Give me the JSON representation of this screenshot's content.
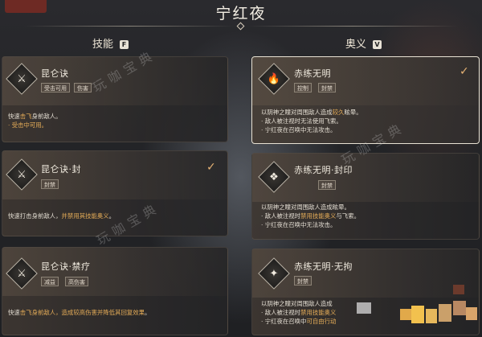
{
  "top_tab": "",
  "window_title": "宁红夜",
  "columns": {
    "skills": {
      "title": "技能",
      "key": "F"
    },
    "ultimates": {
      "title": "奥义",
      "key": "V"
    }
  },
  "watermark": "玩咖宝典",
  "colors": {
    "highlight": "#e6ad58",
    "check": "#e6b274",
    "tag_border": "#8c8376"
  },
  "left_cards": [
    {
      "name": "昆仑诀",
      "icon": "slash-dash-icon",
      "tags": [
        "受击可用",
        "伤害"
      ],
      "desc_prefix": "快速",
      "desc_hl": "击飞",
      "desc_suffix": "身前敌人。",
      "bullet_hl": "· 受击中可用。"
    },
    {
      "name": "昆仑诀·封",
      "icon": "slash-dash-icon",
      "tags": [
        "封禁"
      ],
      "checked": true,
      "desc_prefix": "快速打击身前敌人，",
      "desc_hl": "并禁用其技能奥义",
      "desc_suffix": "。"
    },
    {
      "name": "昆仑诀·禁疗",
      "icon": "slash-dash-icon",
      "tags": [
        "减益",
        "高伤害"
      ],
      "desc_prefix": "快速",
      "desc_hl": "击飞身前敌人，造成较高伤害并降低其回复效果",
      "desc_suffix": "。"
    }
  ],
  "right_cards": [
    {
      "name": "赤练无明",
      "icon": "flame-eye-icon",
      "tags": [
        "控制",
        "封禁"
      ],
      "checked": true,
      "desc_prefix": "以阴神之瞳对周围敌人造成",
      "desc_hl": "较久",
      "desc_suffix": "眩晕。",
      "bullets": [
        "· 敌人被注视时无法使用飞索。",
        "· 宁红夜在召唤中无法攻击。"
      ]
    },
    {
      "name": "赤练无明·封印",
      "icon": "flame-seal-icon",
      "tags": [
        "封禁"
      ],
      "desc_prefix": "以阴神之瞳对周围敌人造成眩晕。",
      "line2_prefix": "· 敌人被注视时",
      "line2_hl": "禁用技能奥义",
      "line2_suffix": "与飞索。",
      "line3": "· 宁红夜在召唤中无法攻击。"
    },
    {
      "name": "赤练无明·无拘",
      "icon": "flame-free-icon",
      "tags": [
        "封禁"
      ],
      "desc_prefix": "以阴神之瞳对周围敌人造成",
      "line2_prefix": "· 敌人被注视时",
      "line2_hl": "禁用技能奥义",
      "line3_prefix": "· 宁红夜在召唤中",
      "line3_hl": "可自由行动"
    }
  ]
}
